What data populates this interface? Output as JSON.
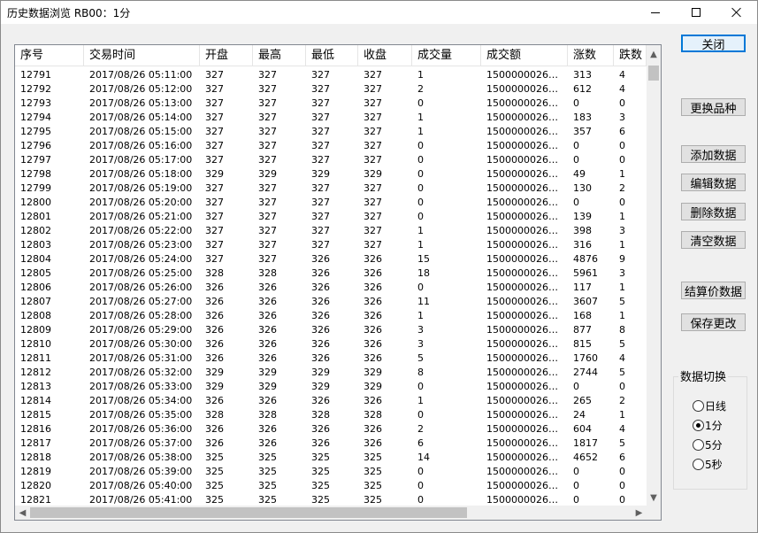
{
  "window": {
    "title": "历史数据浏览 RB00：1分"
  },
  "table": {
    "columns": [
      "序号",
      "交易时间",
      "开盘",
      "最高",
      "最低",
      "收盘",
      "成交量",
      "成交额",
      "涨数",
      "跌数"
    ],
    "rows": [
      [
        "12791",
        "2017/08/26  05:11:00",
        "327",
        "327",
        "327",
        "327",
        "1",
        "15000000266...",
        "313",
        "4"
      ],
      [
        "12792",
        "2017/08/26  05:12:00",
        "327",
        "327",
        "327",
        "327",
        "2",
        "15000000266...",
        "612",
        "4"
      ],
      [
        "12793",
        "2017/08/26  05:13:00",
        "327",
        "327",
        "327",
        "327",
        "0",
        "15000000266...",
        "0",
        "0"
      ],
      [
        "12794",
        "2017/08/26  05:14:00",
        "327",
        "327",
        "327",
        "327",
        "1",
        "15000000266...",
        "183",
        "3"
      ],
      [
        "12795",
        "2017/08/26  05:15:00",
        "327",
        "327",
        "327",
        "327",
        "1",
        "15000000266...",
        "357",
        "6"
      ],
      [
        "12796",
        "2017/08/26  05:16:00",
        "327",
        "327",
        "327",
        "327",
        "0",
        "15000000266...",
        "0",
        "0"
      ],
      [
        "12797",
        "2017/08/26  05:17:00",
        "327",
        "327",
        "327",
        "327",
        "0",
        "15000000266...",
        "0",
        "0"
      ],
      [
        "12798",
        "2017/08/26  05:18:00",
        "329",
        "329",
        "329",
        "329",
        "0",
        "15000000266...",
        "49",
        "1"
      ],
      [
        "12799",
        "2017/08/26  05:19:00",
        "327",
        "327",
        "327",
        "327",
        "0",
        "15000000266...",
        "130",
        "2"
      ],
      [
        "12800",
        "2017/08/26  05:20:00",
        "327",
        "327",
        "327",
        "327",
        "0",
        "15000000266...",
        "0",
        "0"
      ],
      [
        "12801",
        "2017/08/26  05:21:00",
        "327",
        "327",
        "327",
        "327",
        "0",
        "15000000266...",
        "139",
        "1"
      ],
      [
        "12802",
        "2017/08/26  05:22:00",
        "327",
        "327",
        "327",
        "327",
        "1",
        "15000000266...",
        "398",
        "3"
      ],
      [
        "12803",
        "2017/08/26  05:23:00",
        "327",
        "327",
        "327",
        "327",
        "1",
        "15000000266...",
        "316",
        "1"
      ],
      [
        "12804",
        "2017/08/26  05:24:00",
        "327",
        "327",
        "326",
        "326",
        "15",
        "15000000266...",
        "4876",
        "9"
      ],
      [
        "12805",
        "2017/08/26  05:25:00",
        "328",
        "328",
        "326",
        "326",
        "18",
        "15000000266...",
        "5961",
        "3"
      ],
      [
        "12806",
        "2017/08/26  05:26:00",
        "326",
        "326",
        "326",
        "326",
        "0",
        "15000000266...",
        "117",
        "1"
      ],
      [
        "12807",
        "2017/08/26  05:27:00",
        "326",
        "326",
        "326",
        "326",
        "11",
        "15000000266...",
        "3607",
        "5"
      ],
      [
        "12808",
        "2017/08/26  05:28:00",
        "326",
        "326",
        "326",
        "326",
        "1",
        "15000000266...",
        "168",
        "1"
      ],
      [
        "12809",
        "2017/08/26  05:29:00",
        "326",
        "326",
        "326",
        "326",
        "3",
        "15000000266...",
        "877",
        "8"
      ],
      [
        "12810",
        "2017/08/26  05:30:00",
        "326",
        "326",
        "326",
        "326",
        "3",
        "15000000266...",
        "815",
        "5"
      ],
      [
        "12811",
        "2017/08/26  05:31:00",
        "326",
        "326",
        "326",
        "326",
        "5",
        "15000000266...",
        "1760",
        "4"
      ],
      [
        "12812",
        "2017/08/26  05:32:00",
        "329",
        "329",
        "329",
        "329",
        "8",
        "15000000266...",
        "2744",
        "5"
      ],
      [
        "12813",
        "2017/08/26  05:33:00",
        "329",
        "329",
        "329",
        "329",
        "0",
        "15000000266...",
        "0",
        "0"
      ],
      [
        "12814",
        "2017/08/26  05:34:00",
        "326",
        "326",
        "326",
        "326",
        "1",
        "15000000266...",
        "265",
        "2"
      ],
      [
        "12815",
        "2017/08/26  05:35:00",
        "328",
        "328",
        "328",
        "328",
        "0",
        "15000000266...",
        "24",
        "1"
      ],
      [
        "12816",
        "2017/08/26  05:36:00",
        "326",
        "326",
        "326",
        "326",
        "2",
        "15000000266...",
        "604",
        "4"
      ],
      [
        "12817",
        "2017/08/26  05:37:00",
        "326",
        "326",
        "326",
        "326",
        "6",
        "15000000266...",
        "1817",
        "5"
      ],
      [
        "12818",
        "2017/08/26  05:38:00",
        "325",
        "325",
        "325",
        "325",
        "14",
        "15000000266...",
        "4652",
        "6"
      ],
      [
        "12819",
        "2017/08/26  05:39:00",
        "325",
        "325",
        "325",
        "325",
        "0",
        "15000000266...",
        "0",
        "0"
      ],
      [
        "12820",
        "2017/08/26  05:40:00",
        "325",
        "325",
        "325",
        "325",
        "0",
        "15000000266...",
        "0",
        "0"
      ],
      [
        "12821",
        "2017/08/26  05:41:00",
        "325",
        "325",
        "325",
        "325",
        "0",
        "15000000266...",
        "0",
        "0"
      ]
    ]
  },
  "buttons": {
    "close": "关闭",
    "change_symbol": "更换品种",
    "add": "添加数据",
    "edit": "编辑数据",
    "delete": "删除数据",
    "clear": "清空数据",
    "settlement": "结算价数据",
    "save": "保存更改"
  },
  "switch_group": {
    "title": "数据切换",
    "options": [
      {
        "label": "日线",
        "checked": false
      },
      {
        "label": "1分",
        "checked": true
      },
      {
        "label": "5分",
        "checked": false
      },
      {
        "label": "5秒",
        "checked": false
      }
    ]
  }
}
